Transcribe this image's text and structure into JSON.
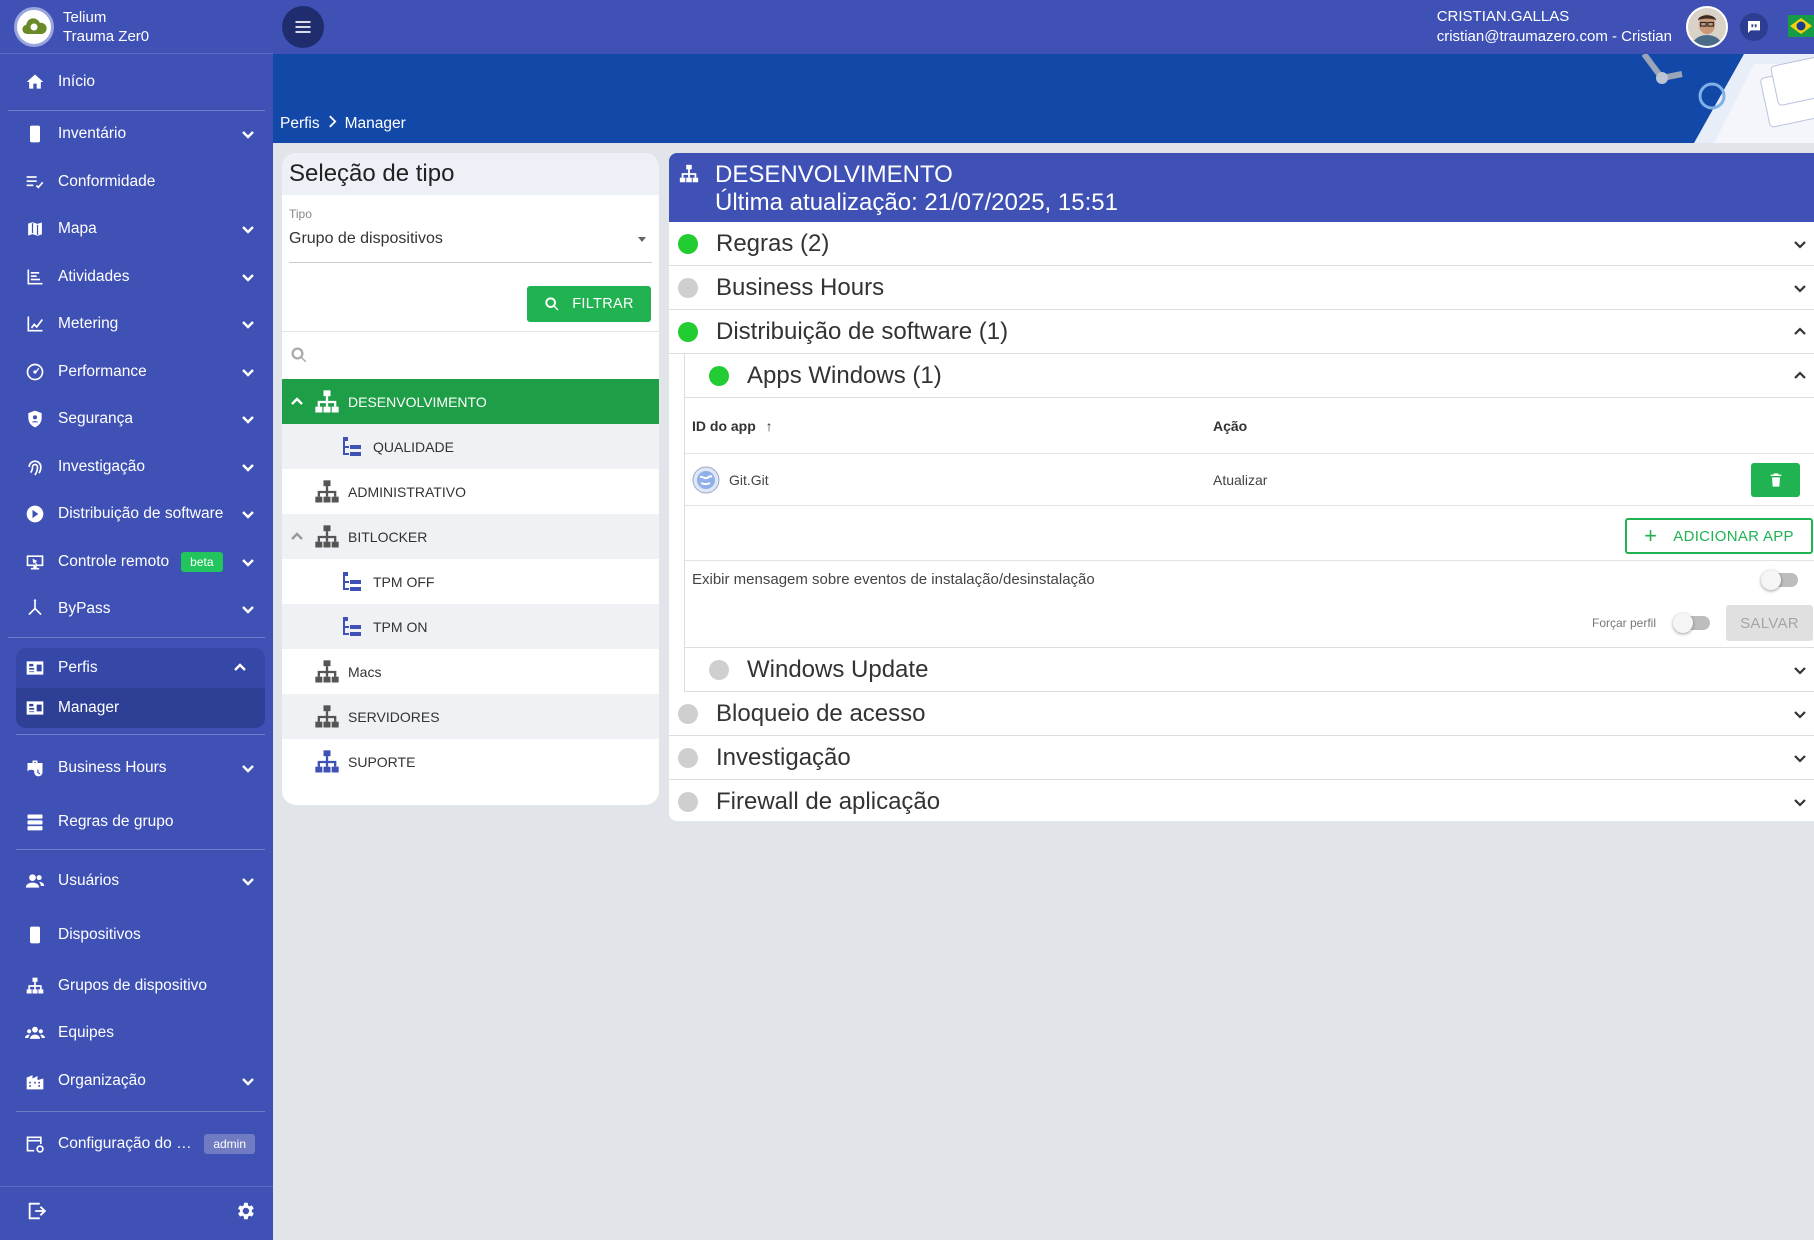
{
  "brand": {
    "line1": "Telium",
    "line2": "Trauma Zer0"
  },
  "sidebar": {
    "items": [
      {
        "label": "Início"
      },
      {
        "label": "Inventário"
      },
      {
        "label": "Conformidade"
      },
      {
        "label": "Mapa"
      },
      {
        "label": "Atividades"
      },
      {
        "label": "Metering"
      },
      {
        "label": "Performance"
      },
      {
        "label": "Segurança"
      },
      {
        "label": "Investigação"
      },
      {
        "label": "Distribuição de software"
      },
      {
        "label": "Controle remoto",
        "badge": "beta"
      },
      {
        "label": "ByPass"
      }
    ],
    "perfis": {
      "label": "Perfis",
      "sub_label": "Manager"
    },
    "items2": [
      {
        "label": "Business Hours"
      },
      {
        "label": "Regras de grupo"
      }
    ],
    "items3": [
      {
        "label": "Usuários"
      },
      {
        "label": "Dispositivos"
      },
      {
        "label": "Grupos de dispositivo"
      },
      {
        "label": "Equipes"
      },
      {
        "label": "Organização"
      }
    ],
    "config": {
      "label": "Configuração do a...",
      "badge": "admin"
    }
  },
  "topbar": {
    "user_name": "CRISTIAN.GALLAS",
    "user_email": "cristian@traumazero.com - Cristian"
  },
  "breadcrumb": {
    "items": [
      "Perfis",
      "Manager"
    ]
  },
  "type_panel": {
    "title": "Seleção de tipo",
    "field_label": "Tipo",
    "field_value": "Grupo de dispositivos",
    "filter_label": "FILTRAR",
    "tree": [
      {
        "label": "DESENVOLVIMENTO"
      },
      {
        "label": "QUALIDADE"
      },
      {
        "label": "ADMINISTRATIVO"
      },
      {
        "label": "BITLOCKER"
      },
      {
        "label": "TPM OFF"
      },
      {
        "label": "TPM ON"
      },
      {
        "label": "Macs"
      },
      {
        "label": "SERVIDORES"
      },
      {
        "label": "SUPORTE"
      }
    ]
  },
  "detail": {
    "title": "DESENVOLVIMENTO",
    "subtitle": "Última atualização: 21/07/2025, 15:51",
    "sections": [
      {
        "label": "Regras (2)",
        "status": "on"
      },
      {
        "label": "Business Hours",
        "status": "off"
      },
      {
        "label": "Distribuição de software (1)",
        "status": "on"
      }
    ],
    "apps_windows": {
      "label": "Apps Windows (1)",
      "col_id": "ID do app",
      "col_action": "Ação",
      "rows": [
        {
          "id": "Git.Git",
          "action": "Atualizar"
        }
      ],
      "add_label": "ADICIONAR APP",
      "msg_label": "Exibir mensagem sobre eventos de instalação/desinstalação",
      "force_label": "Forçar perfil",
      "save_label": "SALVAR"
    },
    "windows_update": {
      "label": "Windows Update",
      "status": "off"
    },
    "sections_after": [
      {
        "label": "Bloqueio de acesso",
        "status": "off"
      },
      {
        "label": "Investigação",
        "status": "off"
      },
      {
        "label": "Firewall de aplicação",
        "status": "off"
      }
    ]
  },
  "colors": {
    "primary": "#3f51b5",
    "banner": "#1248a8",
    "accent_green": "#21b252",
    "status_on": "#22cc33",
    "status_off": "#cfcfcf"
  }
}
